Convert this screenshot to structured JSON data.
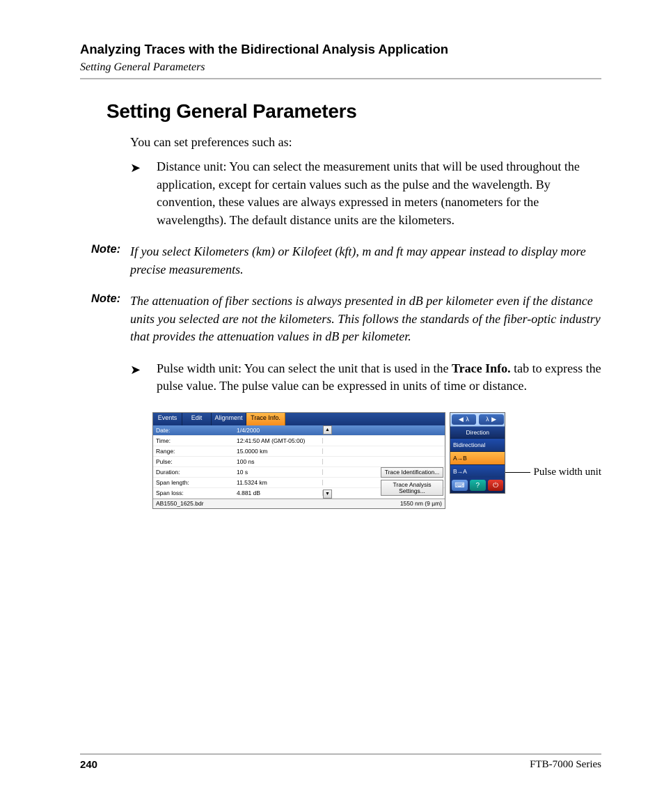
{
  "header": {
    "chapter": "Analyzing Traces with the Bidirectional Analysis Application",
    "section": "Setting General Parameters"
  },
  "heading": "Setting General Parameters",
  "intro": "You can set preferences such as:",
  "bullets": [
    "Distance unit: You can select the measurement units that will be used throughout the application, except for certain values such as the pulse and the wavelength. By convention, these values are always expressed in meters (nanometers for the wavelengths). The default distance units are the kilometers.",
    "Pulse width unit: You can select the unit that is used in the Trace Info. tab to express the pulse value. The pulse value can be expressed in units of time or distance."
  ],
  "bullet2_prefix": "Pulse width unit: You can select the unit that is used in the ",
  "bullet2_bold": "Trace Info.",
  "bullet2_suffix": " tab to express the pulse value. The pulse value can be expressed in units of time or distance.",
  "note_label": "Note:",
  "notes": [
    "If you select Kilometers (km) or Kilofeet (kft), m and ft may appear instead to display more precise measurements.",
    "The attenuation of fiber sections is always presented in dB per kilometer even if the distance units you selected are not the kilometers. This follows the standards of the fiber-optic industry that provides the attenuation values in dB per kilometer."
  ],
  "screenshot": {
    "tabs": {
      "events": "Events",
      "edit": "Edit",
      "alignment": "Alignment",
      "trace_info": "Trace Info."
    },
    "rows": [
      {
        "label": "Date:",
        "value": "1/4/2000"
      },
      {
        "label": "Time:",
        "value": "12:41:50 AM (GMT-05:00)"
      },
      {
        "label": "Range:",
        "value": "15.0000 km"
      },
      {
        "label": "Pulse:",
        "value": "100 ns"
      },
      {
        "label": "Duration:",
        "value": "10 s"
      },
      {
        "label": "Span length:",
        "value": "11.5324 km"
      },
      {
        "label": "Span loss:",
        "value": "4.881 dB"
      }
    ],
    "btn_ident": "Trace Identification...",
    "btn_analysis": "Trace Analysis Settings...",
    "status_left": "AB1550_1625.bdr",
    "status_right": "1550 nm (9 µm)",
    "side": {
      "lambda_left": "◀ λ",
      "lambda_right": "λ ▶",
      "direction_head": "Direction",
      "bidir": "Bidirectional",
      "ab": "A→B",
      "ba": "B→A"
    }
  },
  "callout": "Pulse width unit",
  "footer": {
    "page": "240",
    "model": "FTB-7000 Series"
  }
}
